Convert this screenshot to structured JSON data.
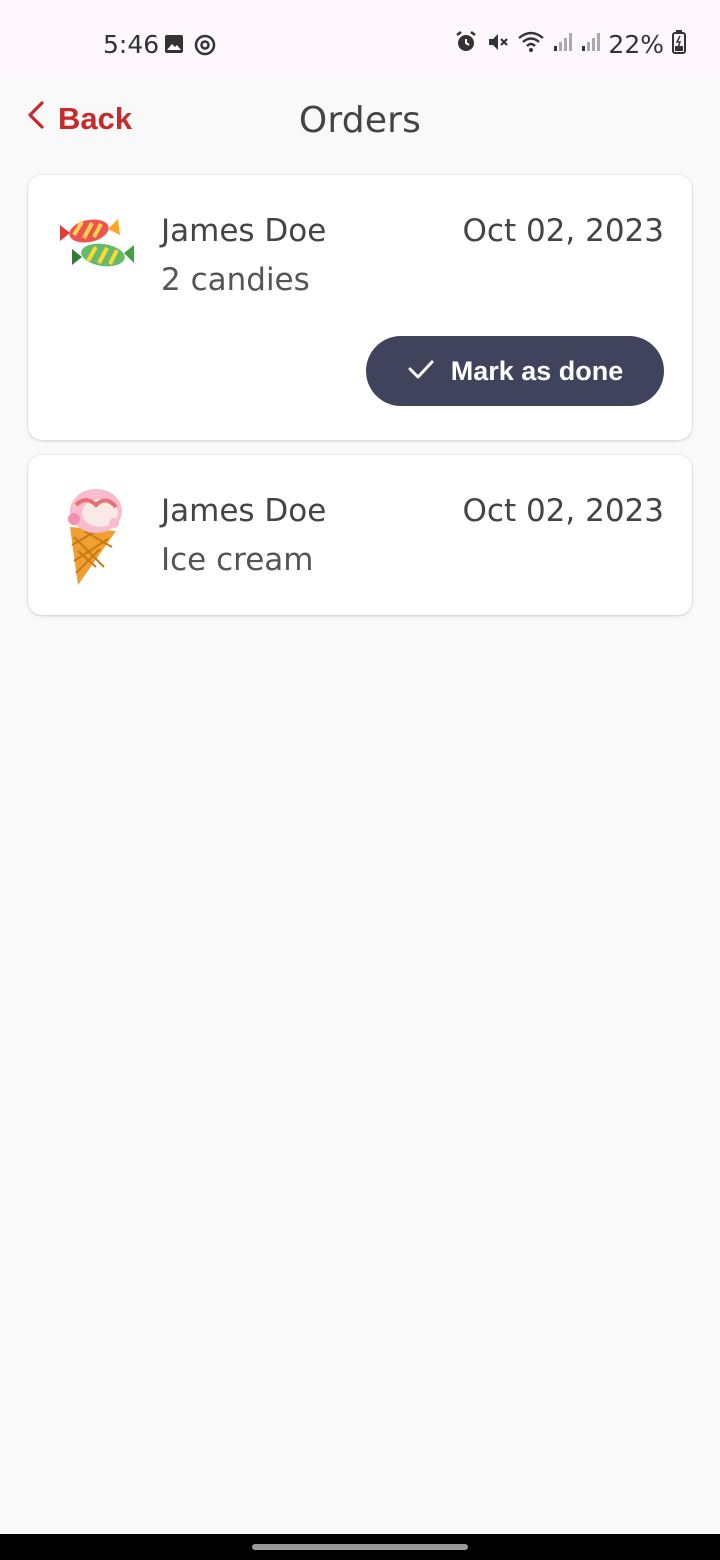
{
  "status_bar": {
    "time": "5:46",
    "battery": "22%",
    "icons_left": [
      "image-icon",
      "sync-icon"
    ],
    "icons_right": [
      "alarm-icon",
      "mute-icon",
      "wifi-icon",
      "signal-icon",
      "signal-icon",
      "battery-icon"
    ]
  },
  "header": {
    "back_label": "Back",
    "title": "Orders",
    "accent_color": "#c62a2a"
  },
  "orders": [
    {
      "customer": "James Doe",
      "item": "2 candies",
      "date": "Oct 02, 2023",
      "image": "candies-icon",
      "action_label": "Mark as done"
    },
    {
      "customer": "James Doe",
      "item": "Ice cream",
      "date": "Oct 02, 2023",
      "image": "ice-cream-icon"
    }
  ],
  "colors": {
    "button_bg": "#3f435c",
    "background": "#f9f9f9"
  }
}
